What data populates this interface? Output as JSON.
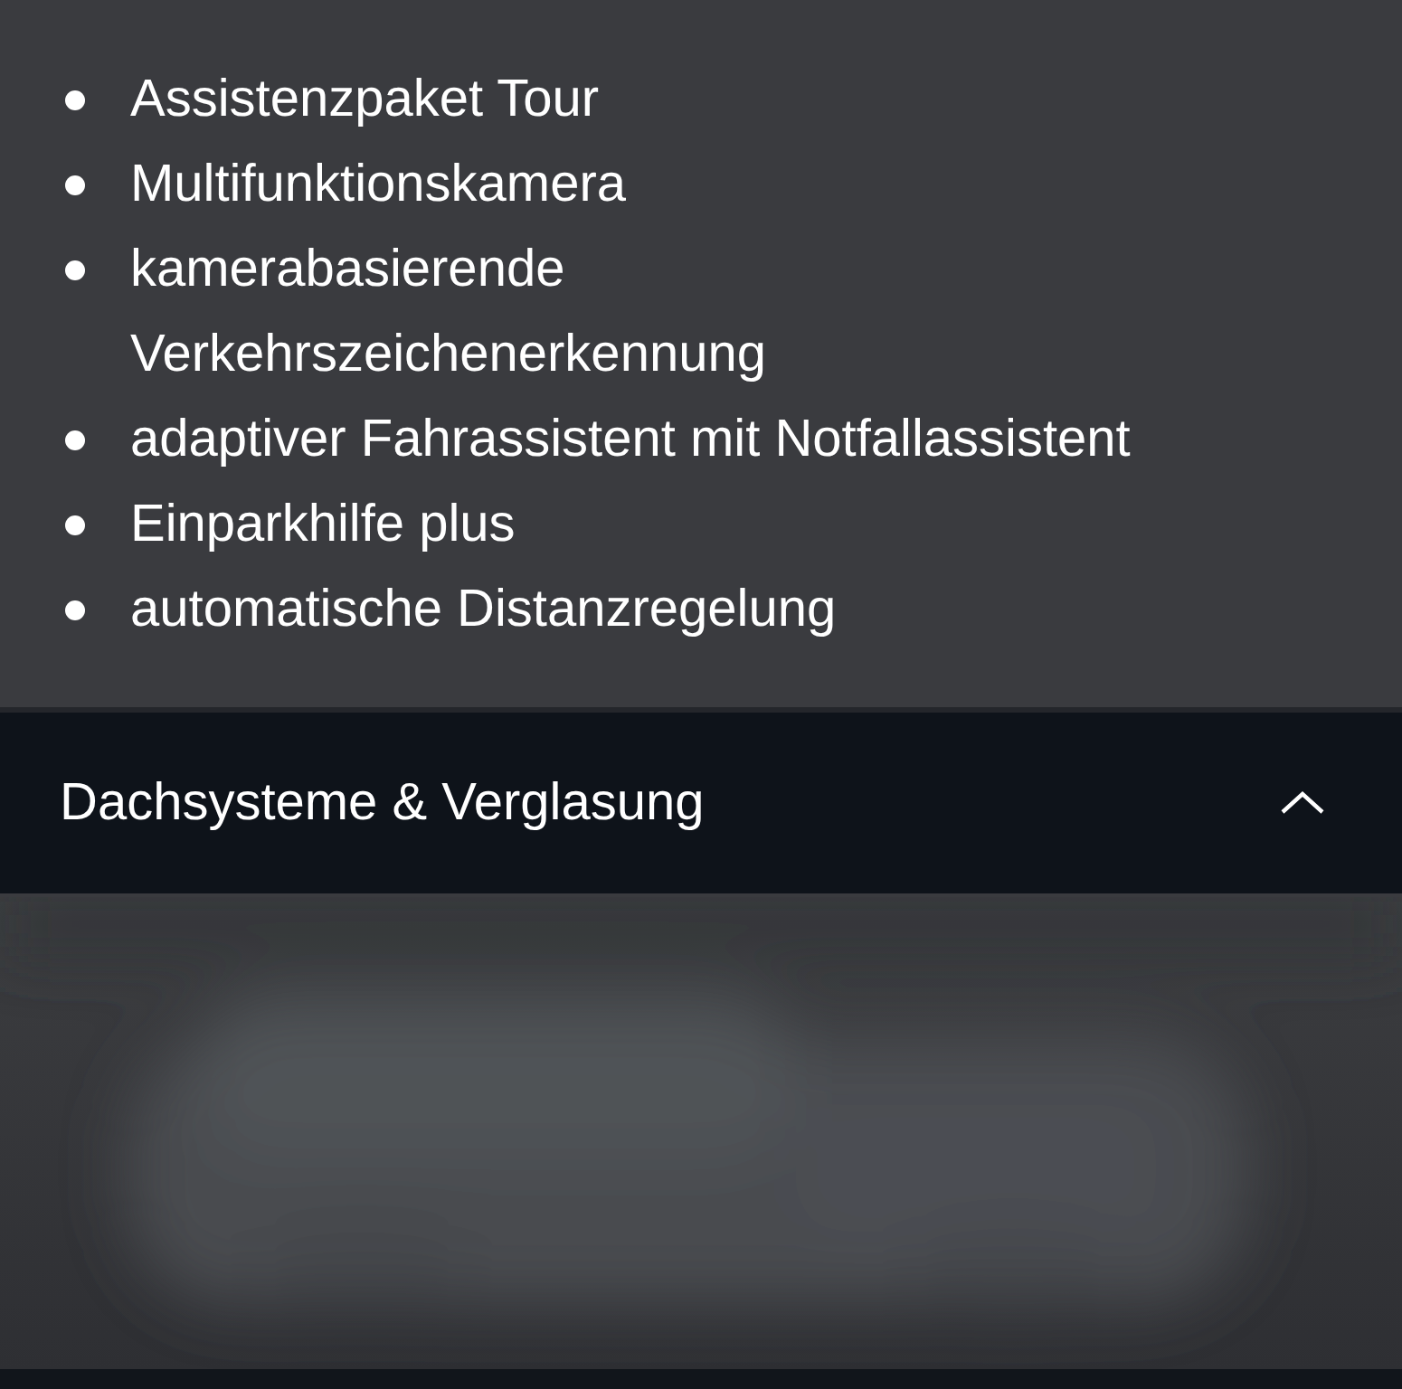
{
  "features": [
    "Assistenzpaket Tour",
    "Multifunktionskamera",
    "kamerabasierende\nVerkehrszeichenerkennung",
    "adaptiver Fahrassistent mit Notfallassistent",
    "Einparkhilfe plus",
    "automatische Distanzregelung"
  ],
  "section": {
    "title": "Dachsysteme & Verglasung",
    "expanded": true
  }
}
